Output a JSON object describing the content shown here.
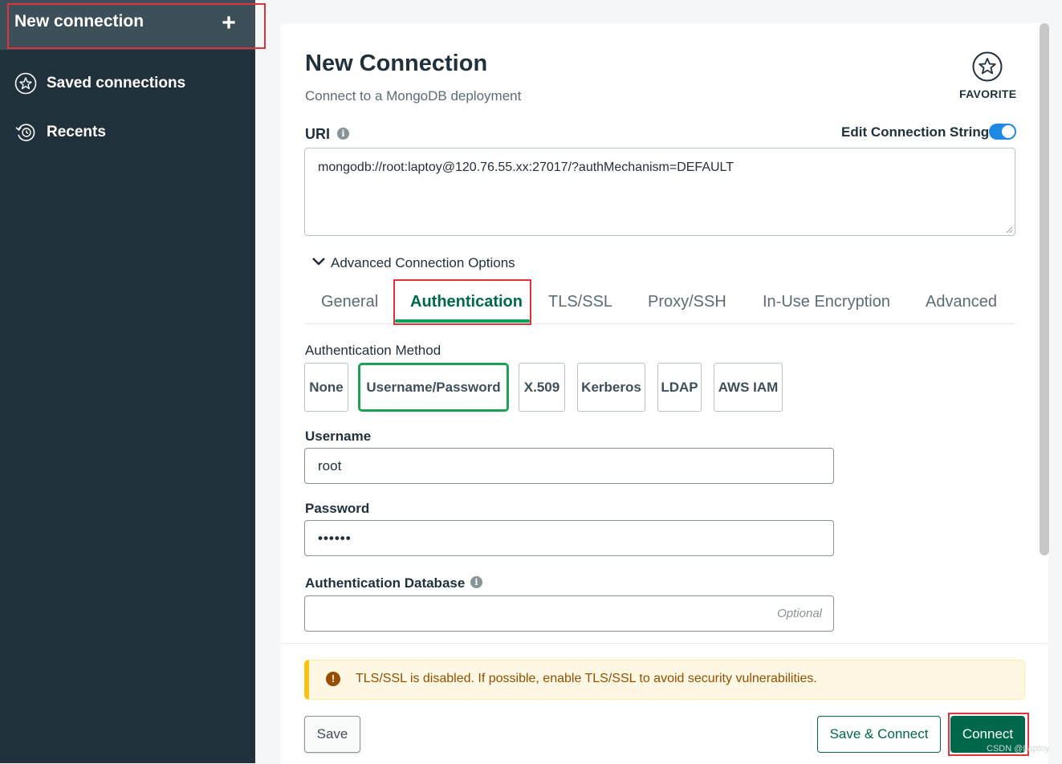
{
  "sidebar": {
    "new_connection": "New connection",
    "plus": "+",
    "items": [
      {
        "label": "Saved connections",
        "icon": "star-circle-icon"
      },
      {
        "label": "Recents",
        "icon": "history-icon"
      }
    ]
  },
  "form": {
    "title": "New Connection",
    "subtitle": "Connect to a MongoDB deployment",
    "favorite_label": "FAVORITE",
    "uri_label": "URI",
    "edit_connection_string_label": "Edit Connection String",
    "edit_connection_string_enabled": true,
    "uri_value": "mongodb://root:laptoy@120.76.55.xx:27017/?authMechanism=DEFAULT",
    "advanced_options_label": "Advanced Connection Options",
    "tabs": [
      "General",
      "Authentication",
      "TLS/SSL",
      "Proxy/SSH",
      "In-Use Encryption",
      "Advanced"
    ],
    "active_tab": "Authentication",
    "auth_method_label": "Authentication Method",
    "auth_methods": [
      "None",
      "Username/Password",
      "X.509",
      "Kerberos",
      "LDAP",
      "AWS IAM"
    ],
    "selected_auth_method": "Username/Password",
    "username_label": "Username",
    "username_value": "root",
    "password_label": "Password",
    "password_value": "••••••",
    "auth_db_label": "Authentication Database",
    "auth_db_placeholder": "Optional"
  },
  "footer": {
    "warning": "TLS/SSL is disabled. If possible, enable TLS/SSL to avoid security vulnerabilities.",
    "warning_icon_glyph": "!",
    "save_label": "Save",
    "save_connect_label": "Save & Connect",
    "connect_label": "Connect"
  },
  "watermark": "CSDN @Laptoy",
  "colors": {
    "sidebar_bg": "#21313c",
    "active_tab": "#00684a",
    "primary_button": "#00684a",
    "selected_method_border": "#1da154",
    "highlight_box": "#e0323c",
    "warning_bg": "#fef7e3",
    "toggle_on": "#1e88e5"
  }
}
